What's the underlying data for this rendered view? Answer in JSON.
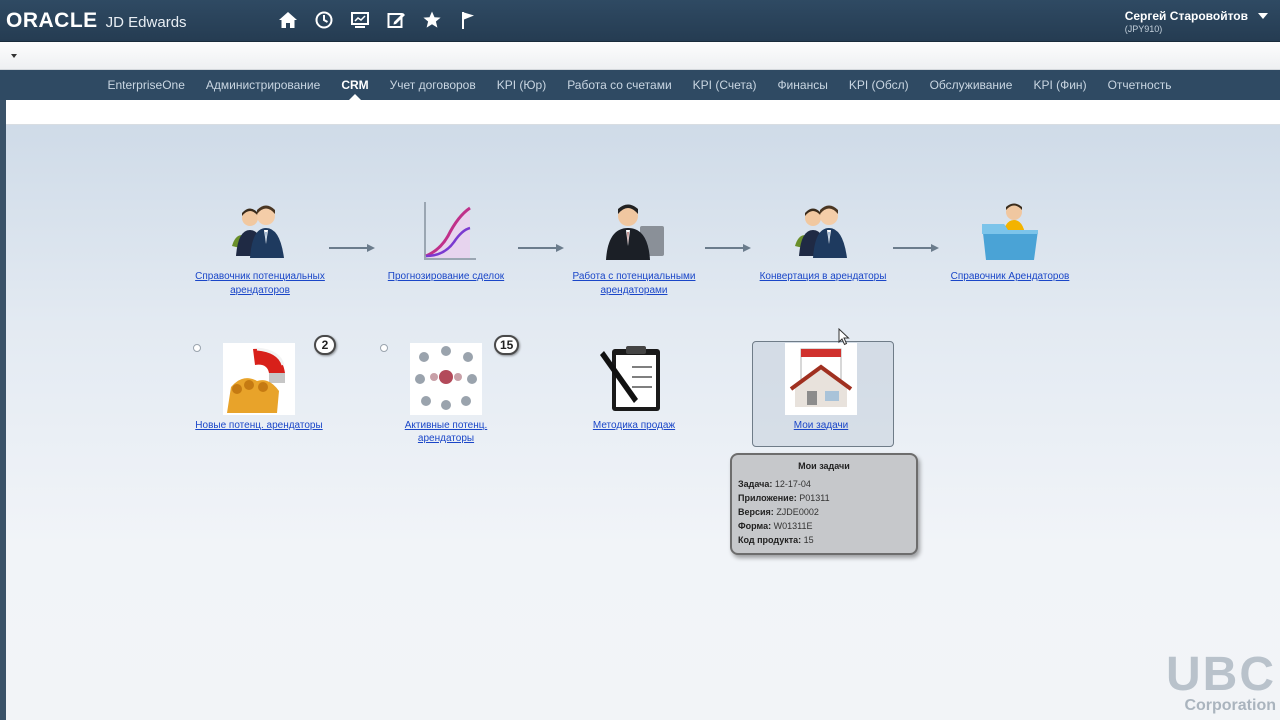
{
  "app": {
    "logo_oracle": "ORACLE",
    "logo_product": "JD Edwards"
  },
  "toolbar_icons": [
    "home-icon",
    "history-icon",
    "monitor-icon",
    "edit-icon",
    "favorites-star-icon",
    "flag-icon"
  ],
  "user": {
    "name": "Сергей Старовойтов",
    "environment": "(JPY910)"
  },
  "nav": {
    "tabs": [
      {
        "label": "EnterpriseOne",
        "active": false
      },
      {
        "label": "Администрирование",
        "active": false
      },
      {
        "label": "CRM",
        "active": true
      },
      {
        "label": "Учет договоров",
        "active": false
      },
      {
        "label": "KPI (Юр)",
        "active": false
      },
      {
        "label": "Работа со счетами",
        "active": false
      },
      {
        "label": "KPI (Счета)",
        "active": false
      },
      {
        "label": "Финансы",
        "active": false
      },
      {
        "label": "KPI (Обсл)",
        "active": false
      },
      {
        "label": "Обслуживание",
        "active": false
      },
      {
        "label": "KPI (Фин)",
        "active": false
      },
      {
        "label": "Отчетность",
        "active": false
      }
    ]
  },
  "process_flow": [
    {
      "label": "Справочник потенциальных арендаторов",
      "icon": "prospects-people-icon"
    },
    {
      "label": "Прогнозирование сделок",
      "icon": "forecast-chart-icon"
    },
    {
      "label": "Работа с потенциальными арендаторами",
      "icon": "manager-folder-icon"
    },
    {
      "label": "Конвертация в арендаторы",
      "icon": "conversion-people-icon"
    },
    {
      "label": "Справочник Арендаторов",
      "icon": "tenant-folder-icon"
    }
  ],
  "tiles": [
    {
      "label": "Новые потенц. арендаторы",
      "badge": "2",
      "icon": "magnet-icon"
    },
    {
      "label": "Активные потенц. арендаторы",
      "badge": "15",
      "icon": "network-people-icon"
    },
    {
      "label": "Методика продаж",
      "badge": "",
      "icon": "clipboard-pen-icon"
    },
    {
      "label": "Мои задачи",
      "badge": "",
      "icon": "tasks-calendar-icon"
    }
  ],
  "tooltip": {
    "title": "Мои задачи",
    "rows": [
      {
        "key": "Задача:",
        "value": "12-17-04"
      },
      {
        "key": "Приложение:",
        "value": "P01311"
      },
      {
        "key": "Версия:",
        "value": "ZJDE0002"
      },
      {
        "key": "Форма:",
        "value": "W01311E"
      },
      {
        "key": "Код продукта:",
        "value": "15"
      }
    ]
  },
  "watermark": {
    "big": "UBC",
    "small": "Corporation"
  },
  "colors": {
    "header": "#2f4a63",
    "link": "#1a46c8"
  }
}
